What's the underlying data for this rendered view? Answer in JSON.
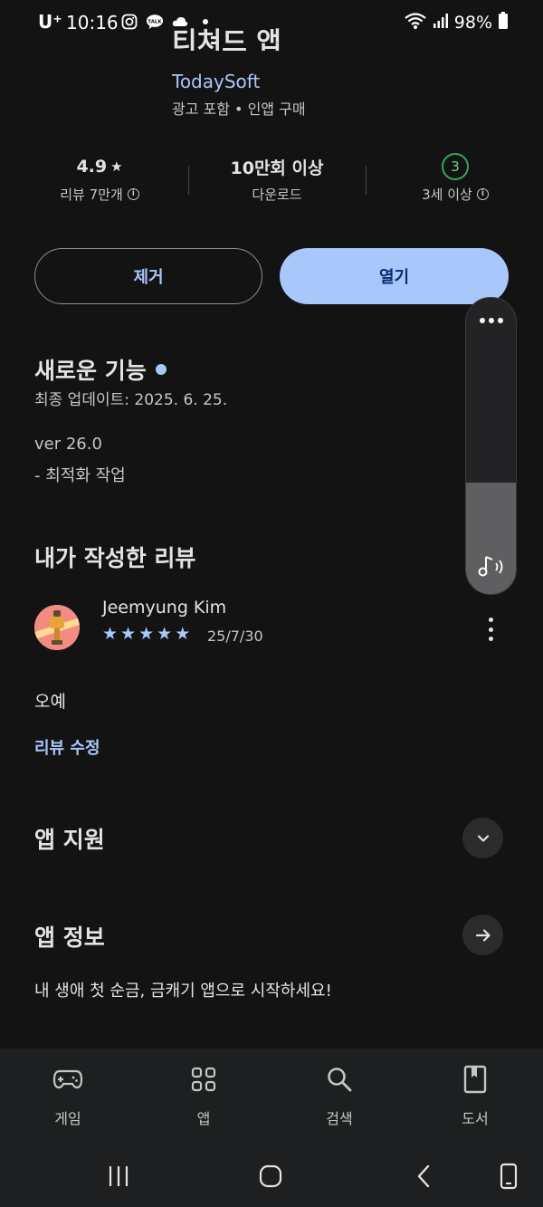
{
  "status_bar": {
    "carrier": "U⁺",
    "time": "10:16",
    "battery": "98%"
  },
  "header": {
    "app_title_cut": "티쳐드 앱",
    "developer": "TodaySoft",
    "meta": "광고 포함  •  인앱 구매"
  },
  "stats": {
    "rating": "4.9",
    "reviews_label": "리뷰 7만개",
    "downloads": "10만회 이상",
    "downloads_label": "다운로드",
    "age_rating": "3",
    "age_label": "3세 이상"
  },
  "buttons": {
    "uninstall": "제거",
    "open": "열기"
  },
  "whats_new": {
    "title": "새로운 기능",
    "updated": "최종 업데이트: 2025. 6. 25.",
    "version": "ver 26.0",
    "note": "- 최적화 작업"
  },
  "my_review": {
    "title": "내가 작성한 리뷰",
    "reviewer": "Jeemyung Kim",
    "stars": 5,
    "date": "25/7/30",
    "text": "오예",
    "edit_label": "리뷰 수정"
  },
  "app_support": {
    "title": "앱 지원"
  },
  "app_info": {
    "title": "앱 정보",
    "description": "내 생애 첫 순금, 금캐기 앱으로 시작하세요!"
  },
  "volume_overlay": {
    "level": 0.25
  },
  "bottom_nav": [
    {
      "label": "게임",
      "icon": "gamepad-icon"
    },
    {
      "label": "앱",
      "icon": "apps-grid-icon"
    },
    {
      "label": "검색",
      "icon": "search-icon"
    },
    {
      "label": "도서",
      "icon": "book-icon"
    }
  ],
  "colors": {
    "background": "#131314",
    "accent": "#a8c7fa",
    "age_badge": "#34a853"
  }
}
